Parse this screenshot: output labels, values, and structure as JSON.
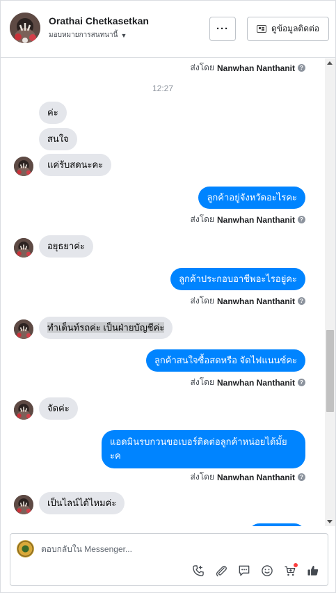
{
  "header": {
    "name": "Orathai Chetkasetkan",
    "assign_label": "มอบหมายการสนทนานี้",
    "more_label": "···",
    "contact_button": "ดูข้อมูลติดต่อ"
  },
  "messages": {
    "sent_by_prefix": "ส่งโดย",
    "agent_name": "Nanwhan Nanthanit",
    "timestamp": "12:27",
    "items": [
      {
        "text": "ค่ะ"
      },
      {
        "text": "สนใจ"
      },
      {
        "text": "แค่รับสดนะคะ"
      },
      {
        "text": "ลูกค้าอยู่จังหวัดอะไรคะ"
      },
      {
        "text": "อยุธยาค่ะ"
      },
      {
        "text": "ลูกค้าประกอบอาชีพอะไรอยู่คะ"
      },
      {
        "text": "ทำเด็นท์รถค่ะ เป็นฝ่ายบัญชีค่ะ"
      },
      {
        "text": "ลูกค้าสนใจซื้อสดหรือ จัดไฟแนนซ์คะ"
      },
      {
        "text": "จัดค่ะ"
      },
      {
        "text": "แอดมินรบกวนขอเบอร์ติดต่อลูกค้าหน่อยได้มั้ยะค"
      },
      {
        "text": "เป็นไลน์ได้ไหมค่ะ"
      }
    ]
  },
  "composer": {
    "placeholder": "ตอบกลับใน Messenger..."
  },
  "colors": {
    "outgoing_bubble": "#0084ff",
    "incoming_bubble": "#e4e6eb",
    "notification_dot": "#fa3e3e"
  },
  "icons": [
    "more-icon",
    "contact-card-icon",
    "help-icon",
    "call-icon",
    "attachment-icon",
    "saved-reply-icon",
    "emoji-icon",
    "cart-icon",
    "like-icon"
  ]
}
